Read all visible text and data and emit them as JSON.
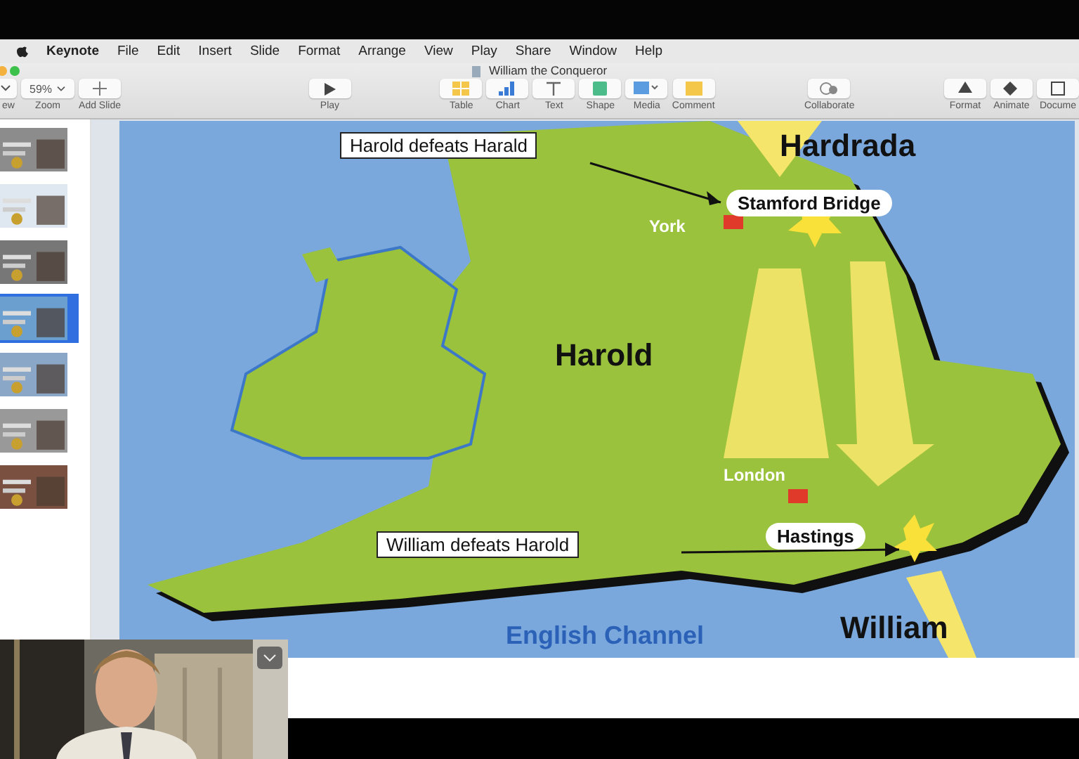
{
  "menu_bar": {
    "app": "Keynote",
    "items": [
      "File",
      "Edit",
      "Insert",
      "Slide",
      "Format",
      "Arrange",
      "View",
      "Play",
      "Share",
      "Window",
      "Help"
    ]
  },
  "window": {
    "title": "William the Conqueror"
  },
  "toolbar": {
    "groups": [
      {
        "items": [
          {
            "kind": "view",
            "label": "ew"
          },
          {
            "kind": "zoom",
            "label": "Zoom",
            "value": "59%"
          },
          {
            "kind": "add",
            "label": "Add Slide"
          }
        ]
      },
      {
        "items": [
          {
            "kind": "play",
            "label": "Play"
          }
        ]
      },
      {
        "items": [
          {
            "kind": "table",
            "label": "Table"
          },
          {
            "kind": "chart",
            "label": "Chart"
          },
          {
            "kind": "text",
            "label": "Text"
          },
          {
            "kind": "shape",
            "label": "Shape"
          },
          {
            "kind": "media",
            "label": "Media"
          },
          {
            "kind": "comment",
            "label": "Comment"
          }
        ]
      },
      {
        "items": [
          {
            "kind": "collaborate",
            "label": "Collaborate"
          }
        ]
      },
      {
        "items": [
          {
            "kind": "format",
            "label": "Format"
          },
          {
            "kind": "animate",
            "label": "Animate"
          },
          {
            "kind": "document",
            "label": "Docume"
          }
        ]
      }
    ]
  },
  "slides": [
    {
      "selected": false
    },
    {
      "selected": false
    },
    {
      "selected": false
    },
    {
      "selected": true
    },
    {
      "selected": false
    },
    {
      "selected": false
    },
    {
      "selected": false
    }
  ],
  "slide": {
    "labels": [
      {
        "kind": "title",
        "text": "Hardrada"
      },
      {
        "kind": "boxed",
        "text": "Harold defeats Harald"
      },
      {
        "kind": "oval",
        "text": "Stamford Bridge"
      },
      {
        "kind": "city",
        "text": "York"
      },
      {
        "kind": "title",
        "text": "Harold"
      },
      {
        "kind": "city",
        "text": "London"
      },
      {
        "kind": "oval",
        "text": "Hastings"
      },
      {
        "kind": "boxed",
        "text": "William defeats Harold"
      },
      {
        "kind": "sea",
        "text": "English Channel"
      },
      {
        "kind": "title",
        "text": "William"
      }
    ]
  }
}
